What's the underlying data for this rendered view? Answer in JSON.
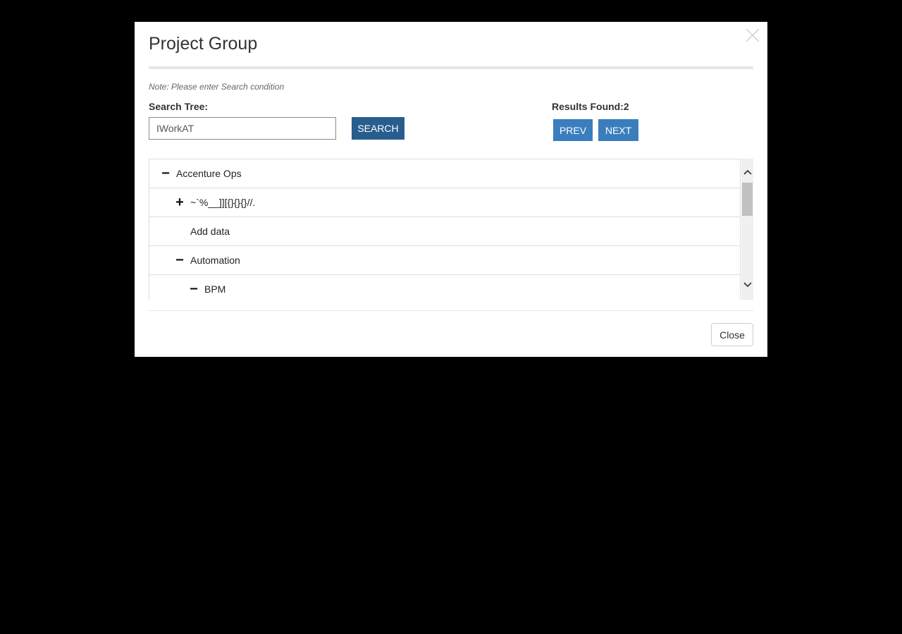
{
  "dialog": {
    "title": "Project Group",
    "close_icon": "close-x-icon",
    "note": "Note: Please enter Search condition"
  },
  "search": {
    "label": "Search Tree:",
    "value": "IWorkAT",
    "button_label": "SEARCH"
  },
  "results": {
    "label": "Results Found:2",
    "prev_label": "PREV",
    "next_label": "NEXT"
  },
  "tree": {
    "items": [
      {
        "label": "Accenture Ops",
        "toggle": "−",
        "toggle_icon": "collapse-minus-icon"
      },
      {
        "label": "~`%__]][{}{}{}//.",
        "toggle": "+",
        "toggle_icon": "expand-plus-icon"
      },
      {
        "label": "Add data",
        "toggle": "",
        "toggle_icon": ""
      },
      {
        "label": "Automation",
        "toggle": "−",
        "toggle_icon": "collapse-minus-icon"
      },
      {
        "label": "BPM",
        "toggle": "−",
        "toggle_icon": "collapse-minus-icon"
      }
    ]
  },
  "footer": {
    "close_label": "Close"
  },
  "colors": {
    "overlay": "#000000",
    "search_button": "#275e8e",
    "nav_button": "#3a7ebd"
  }
}
